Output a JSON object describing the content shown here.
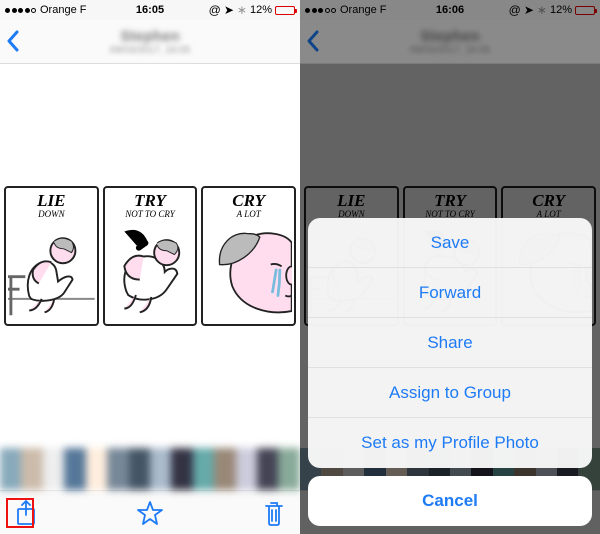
{
  "left": {
    "status": {
      "carrier": "Orange F",
      "time": "16:05",
      "battery_pct": "12%"
    },
    "nav": {
      "title": "Stephen",
      "subtitle": "09/03/2017, 16:05"
    },
    "meme": {
      "panel1": {
        "line1": "LIE",
        "line2": "DOWN"
      },
      "panel2": {
        "line1": "TRY",
        "line2": "NOT TO CRY"
      },
      "panel3": {
        "line1": "CRY",
        "line2": "A LOT"
      }
    }
  },
  "right": {
    "status": {
      "carrier": "Orange F",
      "time": "16:06",
      "battery_pct": "12%"
    },
    "nav": {
      "title": "Stephen",
      "subtitle": "09/03/2017, 16:05"
    },
    "meme": {
      "panel1": {
        "line1": "LIE",
        "line2": "DOWN"
      },
      "panel2": {
        "line1": "TRY",
        "line2": "NOT TO CRY"
      },
      "panel3": {
        "line1": "CRY",
        "line2": "A LOT"
      }
    },
    "actionsheet": {
      "items": [
        "Save",
        "Forward",
        "Share",
        "Assign to Group",
        "Set as my Profile Photo"
      ],
      "cancel": "Cancel"
    }
  },
  "colors": {
    "ios_blue": "#1e7bf6",
    "battery_red": "#d00"
  }
}
